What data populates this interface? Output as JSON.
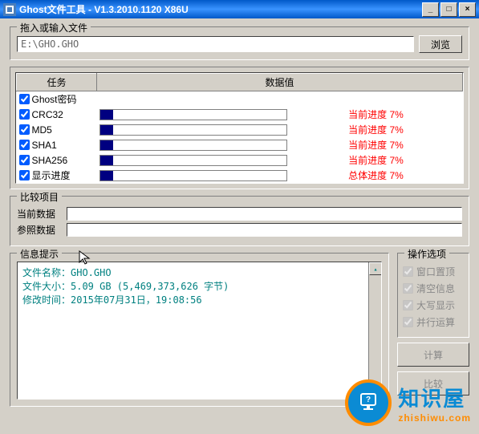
{
  "window": {
    "title": "Ghost文件工具 - V1.3.2010.1120 X86U"
  },
  "drag_input": {
    "legend": "拖入或输入文件",
    "path": "E:\\GHO.GHO",
    "browse": "浏览"
  },
  "task_table": {
    "headers": {
      "task": "任务",
      "value": "数据值"
    },
    "rows": [
      {
        "label": "Ghost密码",
        "checked": true,
        "has_progress": false,
        "value": ""
      },
      {
        "label": "CRC32",
        "checked": true,
        "has_progress": true,
        "pct": 7,
        "value": "当前进度 7%"
      },
      {
        "label": "MD5",
        "checked": true,
        "has_progress": true,
        "pct": 7,
        "value": "当前进度 7%"
      },
      {
        "label": "SHA1",
        "checked": true,
        "has_progress": true,
        "pct": 7,
        "value": "当前进度 7%"
      },
      {
        "label": "SHA256",
        "checked": true,
        "has_progress": true,
        "pct": 7,
        "value": "当前进度 7%"
      },
      {
        "label": "显示进度",
        "checked": true,
        "has_progress": true,
        "pct": 7,
        "value": "总体进度 7%"
      }
    ]
  },
  "compare": {
    "legend": "比较项目",
    "current": "当前数据",
    "ref": "参照数据"
  },
  "info": {
    "legend": "信息提示",
    "lines": [
      "文件名称：GHO.GHO",
      "文件大小：5.09 GB (5,469,373,626 字节)",
      "修改时间：2015年07月31日，19:08:56"
    ]
  },
  "options": {
    "legend": "操作选项",
    "items": [
      {
        "label": "窗口置顶",
        "checked": true
      },
      {
        "label": "清空信息",
        "checked": true
      },
      {
        "label": "大写显示",
        "checked": true
      },
      {
        "label": "并行运算",
        "checked": true
      }
    ],
    "calc": "计算",
    "compare_btn": "比较"
  },
  "watermark": {
    "zh": "知识屋",
    "en": "zhishiwu.com"
  }
}
